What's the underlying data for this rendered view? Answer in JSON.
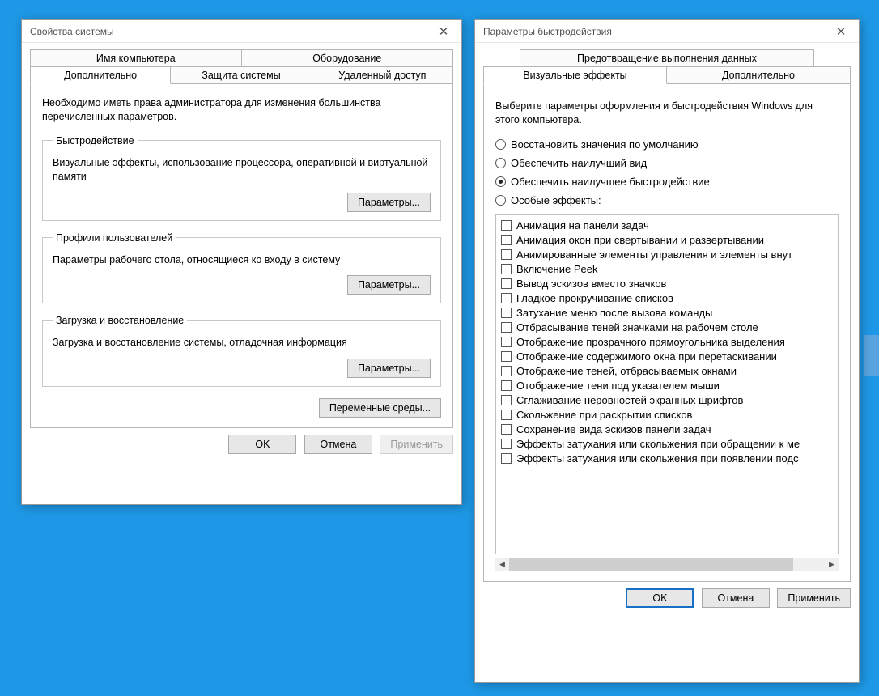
{
  "window1": {
    "title": "Свойства системы",
    "tabs_row1": [
      "Имя компьютера",
      "Оборудование"
    ],
    "tabs_row2": [
      "Дополнительно",
      "Защита системы",
      "Удаленный доступ"
    ],
    "active_tab": "Дополнительно",
    "intro": "Необходимо иметь права администратора для изменения большинства перечисленных параметров.",
    "sections": {
      "perf": {
        "legend": "Быстродействие",
        "desc": "Визуальные эффекты, использование процессора, оперативной и виртуальной памяти",
        "button": "Параметры..."
      },
      "profiles": {
        "legend": "Профили пользователей",
        "desc": "Параметры рабочего стола, относящиеся ко входу в систему",
        "button": "Параметры..."
      },
      "startup": {
        "legend": "Загрузка и восстановление",
        "desc": "Загрузка и восстановление системы, отладочная информация",
        "button": "Параметры..."
      }
    },
    "env_button": "Переменные среды...",
    "actions": {
      "ok": "OK",
      "cancel": "Отмена",
      "apply": "Применить"
    }
  },
  "window2": {
    "title": "Параметры быстродействия",
    "tabs_row1": [
      "Предотвращение выполнения данных"
    ],
    "tabs_row2": [
      "Визуальные эффекты",
      "Дополнительно"
    ],
    "active_tab": "Визуальные эффекты",
    "intro": "Выберите параметры оформления и быстродействия Windows для этого компьютера.",
    "radios": [
      {
        "label": "Восстановить значения по умолчанию",
        "checked": false
      },
      {
        "label": "Обеспечить наилучший вид",
        "checked": false
      },
      {
        "label": "Обеспечить наилучшее быстродействие",
        "checked": true
      },
      {
        "label": "Особые эффекты:",
        "checked": false
      }
    ],
    "effects": [
      "Анимация на панели задач",
      "Анимация окон при свертывании и развертывании",
      "Анимированные элементы управления и элементы внут",
      "Включение Peek",
      "Вывод эскизов вместо значков",
      "Гладкое прокручивание списков",
      "Затухание меню после вызова команды",
      "Отбрасывание теней значками на рабочем столе",
      "Отображение прозрачного прямоугольника выделения",
      "Отображение содержимого окна при перетаскивании",
      "Отображение теней, отбрасываемых окнами",
      "Отображение тени под указателем мыши",
      "Сглаживание неровностей экранных шрифтов",
      "Скольжение при раскрытии списков",
      "Сохранение вида эскизов панели задач",
      "Эффекты затухания или скольжения при обращении к ме",
      "Эффекты затухания или скольжения при появлении подс"
    ],
    "actions": {
      "ok": "OK",
      "cancel": "Отмена",
      "apply": "Применить"
    }
  }
}
